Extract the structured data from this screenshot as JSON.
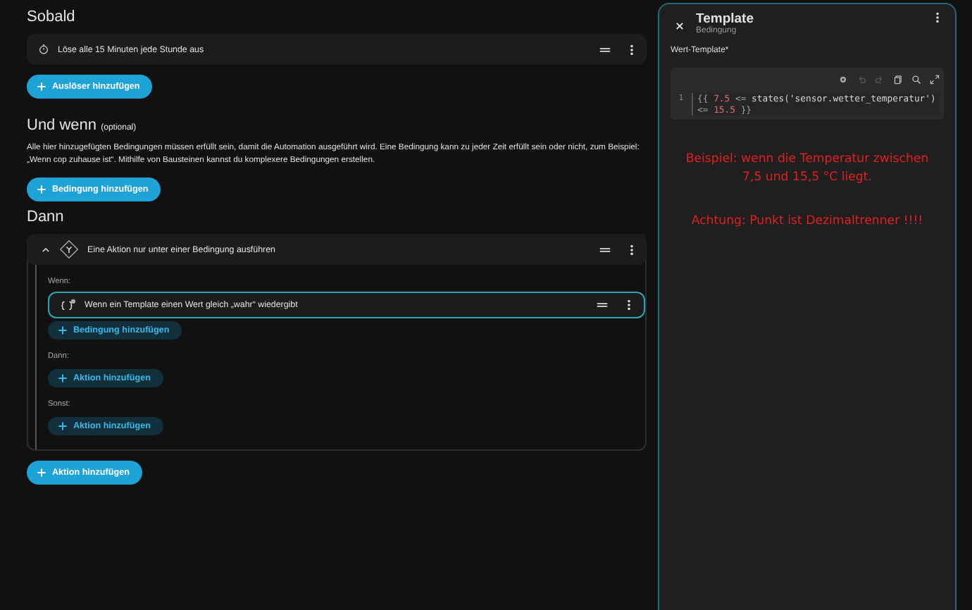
{
  "triggers": {
    "heading": "Sobald",
    "items": [
      {
        "label": "Löse alle 15 Minuten jede Stunde aus"
      }
    ],
    "add_button": "Auslöser hinzufügen"
  },
  "conditions": {
    "heading": "Und wenn",
    "optional": "(optional)",
    "description": "Alle hier hinzugefügten Bedingungen müssen erfüllt sein, damit die Automation ausgeführt wird. Eine Bedingung kann zu jeder Zeit erfüllt sein oder nicht, zum Beispiel: „Wenn cop zuhause ist“. Mithilfe von Bausteinen kannst du komplexere Bedingungen erstellen.",
    "add_button": "Bedingung hinzufügen"
  },
  "actions": {
    "heading": "Dann",
    "items": [
      {
        "label": "Eine Aktion nur unter einer Bedingung ausführen",
        "expanded": true,
        "if_label": "Wenn:",
        "if_items": [
          {
            "label": "Wenn ein Template einen Wert gleich „wahr“ wiedergibt",
            "selected": true
          }
        ],
        "if_add": "Bedingung hinzufügen",
        "then_label": "Dann:",
        "then_add": "Aktion hinzufügen",
        "else_label": "Sonst:",
        "else_add": "Aktion hinzufügen"
      }
    ],
    "add_button": "Aktion hinzufügen"
  },
  "panel": {
    "title": "Template",
    "subtitle": "Bedingung",
    "field_label": "Wert-Template*",
    "line_number": "1",
    "code": [
      {
        "kind": "brace",
        "text": "{{"
      },
      {
        "kind": "number",
        "text": "7.5"
      },
      {
        "kind": "op",
        "text": "<="
      },
      {
        "kind": "plain",
        "text": "states('sensor.wetter_temperatur')"
      },
      {
        "kind": "op",
        "text": "<="
      },
      {
        "kind": "number",
        "text": "15.5"
      },
      {
        "kind": "brace",
        "text": "}}"
      }
    ],
    "notes": [
      "Beispiel:  wenn die Temperatur zwischen 7,5 und 15,5 °C liegt.",
      "Achtung: Punkt ist Dezimaltrenner !!!!"
    ]
  }
}
